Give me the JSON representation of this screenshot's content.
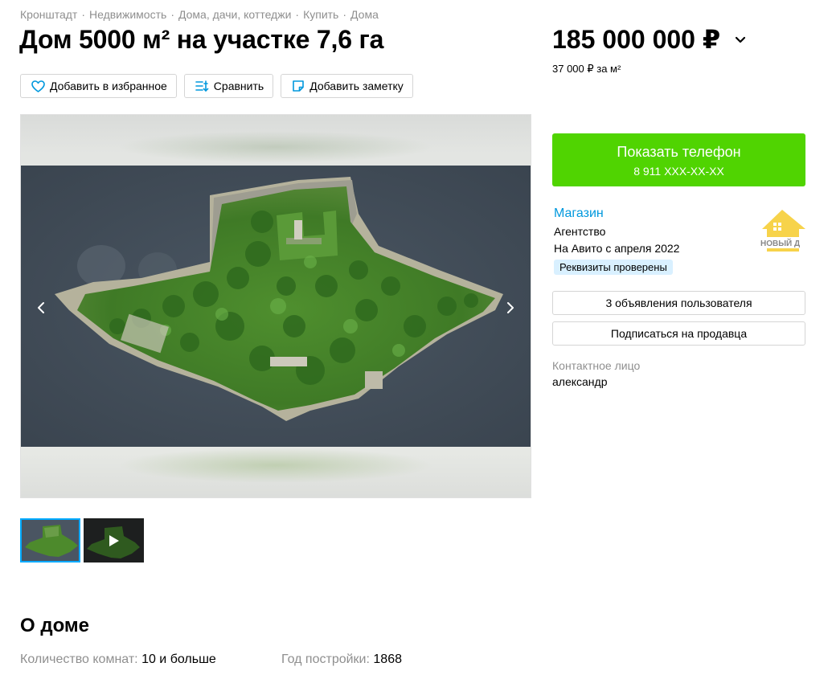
{
  "breadcrumb": [
    "Кронштадт",
    "Недвижимость",
    "Дома, дачи, коттеджи",
    "Купить",
    "Дома"
  ],
  "breadcrumb_separator": "·",
  "title": "Дом 5000 м² на участке 7,6 га",
  "actions": {
    "favorite": "Добавить в избранное",
    "compare": "Сравнить",
    "note": "Добавить заметку"
  },
  "icons": {
    "favorite": "heart-icon",
    "compare": "compare-icon",
    "note": "note-icon",
    "price_toggle": "chevron-down-icon",
    "prev": "chevron-left-icon",
    "next": "chevron-right-icon",
    "video": "play-icon"
  },
  "price": {
    "value": "185 000 000 ₽",
    "per_sqm": "37 000 ₽ за м²"
  },
  "phone": {
    "label": "Показать телефон",
    "number": "8 911 XXX-XX-XX"
  },
  "seller": {
    "name": "Магазин",
    "type": "Агентство",
    "since": "На Авито с апреля 2022",
    "badge": "Реквизиты проверены",
    "logo_text": "НОВЫЙ Д"
  },
  "seller_actions": {
    "listings": "3 объявления пользователя",
    "subscribe": "Подписаться на продавца"
  },
  "contact": {
    "label": "Контактное лицо",
    "name": "александр"
  },
  "about": {
    "title": "О доме",
    "params": [
      {
        "key": "Количество комнат:",
        "value": "10 и больше"
      },
      {
        "key": "Год постройки:",
        "value": "1868"
      }
    ]
  },
  "colors": {
    "accent_green": "#50d401",
    "link_blue": "#0098dd",
    "badge_bg": "#d9f0ff",
    "muted": "#8f8f8f",
    "thumb_active": "#00aaff"
  }
}
